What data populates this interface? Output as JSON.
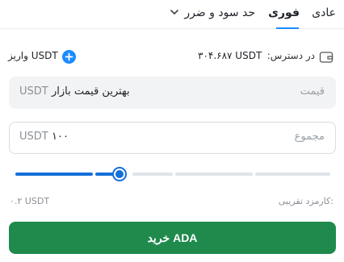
{
  "tabs": {
    "normal": "عادی",
    "instant": "فوری",
    "tpsl": "حد سود و ضرر",
    "active": "instant"
  },
  "available": {
    "label": "در دسترس:",
    "value": "۳۰۴.۶۸۷ USDT"
  },
  "deposit": {
    "label": "واریز USDT"
  },
  "price_field": {
    "label": "قیمت",
    "value": "بهترین قیمت بازار",
    "unit": "USDT"
  },
  "total_field": {
    "label": "مجموع",
    "value": "۱۰۰",
    "unit": "USDT"
  },
  "slider": {
    "level": 0.33
  },
  "fee": {
    "label": "کارمزد تقریبی:",
    "value": "۰.۲ USDT"
  },
  "buy_button": {
    "label": "خرید ADA"
  },
  "colors": {
    "accent": "#1570d9",
    "tab_underline": "#1a8cff",
    "buy": "#1f8a4c"
  },
  "icons": {
    "wallet": "wallet-icon",
    "plus": "plus-circle-icon",
    "chevron": "chevron-down-icon"
  }
}
